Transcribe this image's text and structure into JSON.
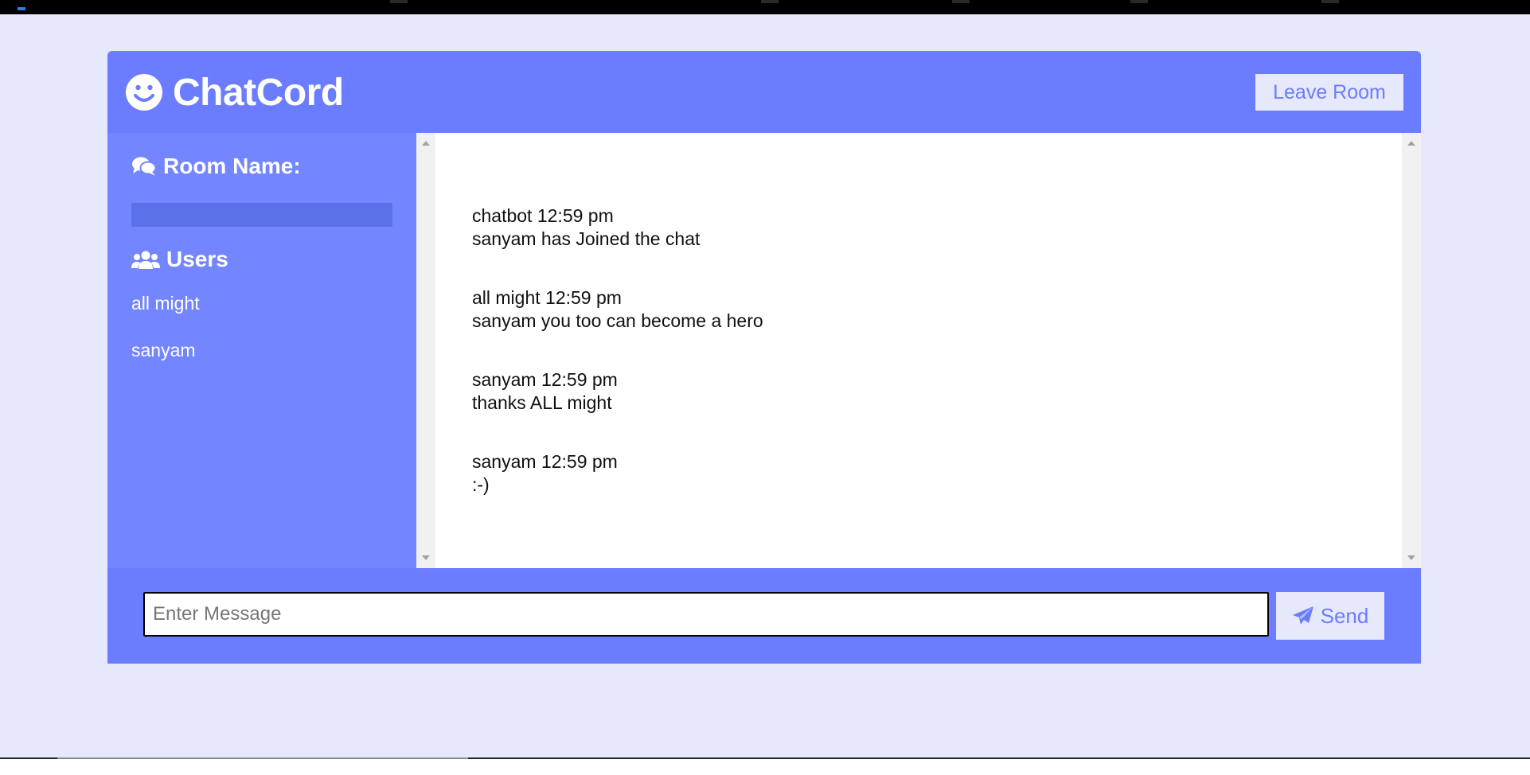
{
  "header": {
    "brand_icon": "smile-icon",
    "title": "ChatCord",
    "leave_label": "Leave Room"
  },
  "sidebar": {
    "room_heading_icon": "comments-icon",
    "room_heading": "Room Name:",
    "room_name": "",
    "users_heading_icon": "users-icon",
    "users_heading": "Users",
    "users": [
      "all might",
      "sanyam"
    ]
  },
  "messages": [
    {
      "user": "chatbot",
      "time": "12:59 pm",
      "text": "sanyam has Joined the chat"
    },
    {
      "user": "all might",
      "time": "12:59 pm",
      "text": "sanyam you too can become a hero"
    },
    {
      "user": "sanyam",
      "time": "12:59 pm",
      "text": "thanks ALL might"
    },
    {
      "user": "sanyam",
      "time": "12:59 pm",
      "text": ":-)"
    }
  ],
  "form": {
    "placeholder": "Enter Message",
    "value": "",
    "send_icon": "paper-plane-icon",
    "send_label": "Send"
  },
  "colors": {
    "primary": "#6b7cff",
    "sidebar": "#7385ff",
    "light": "#e6e8fc"
  }
}
